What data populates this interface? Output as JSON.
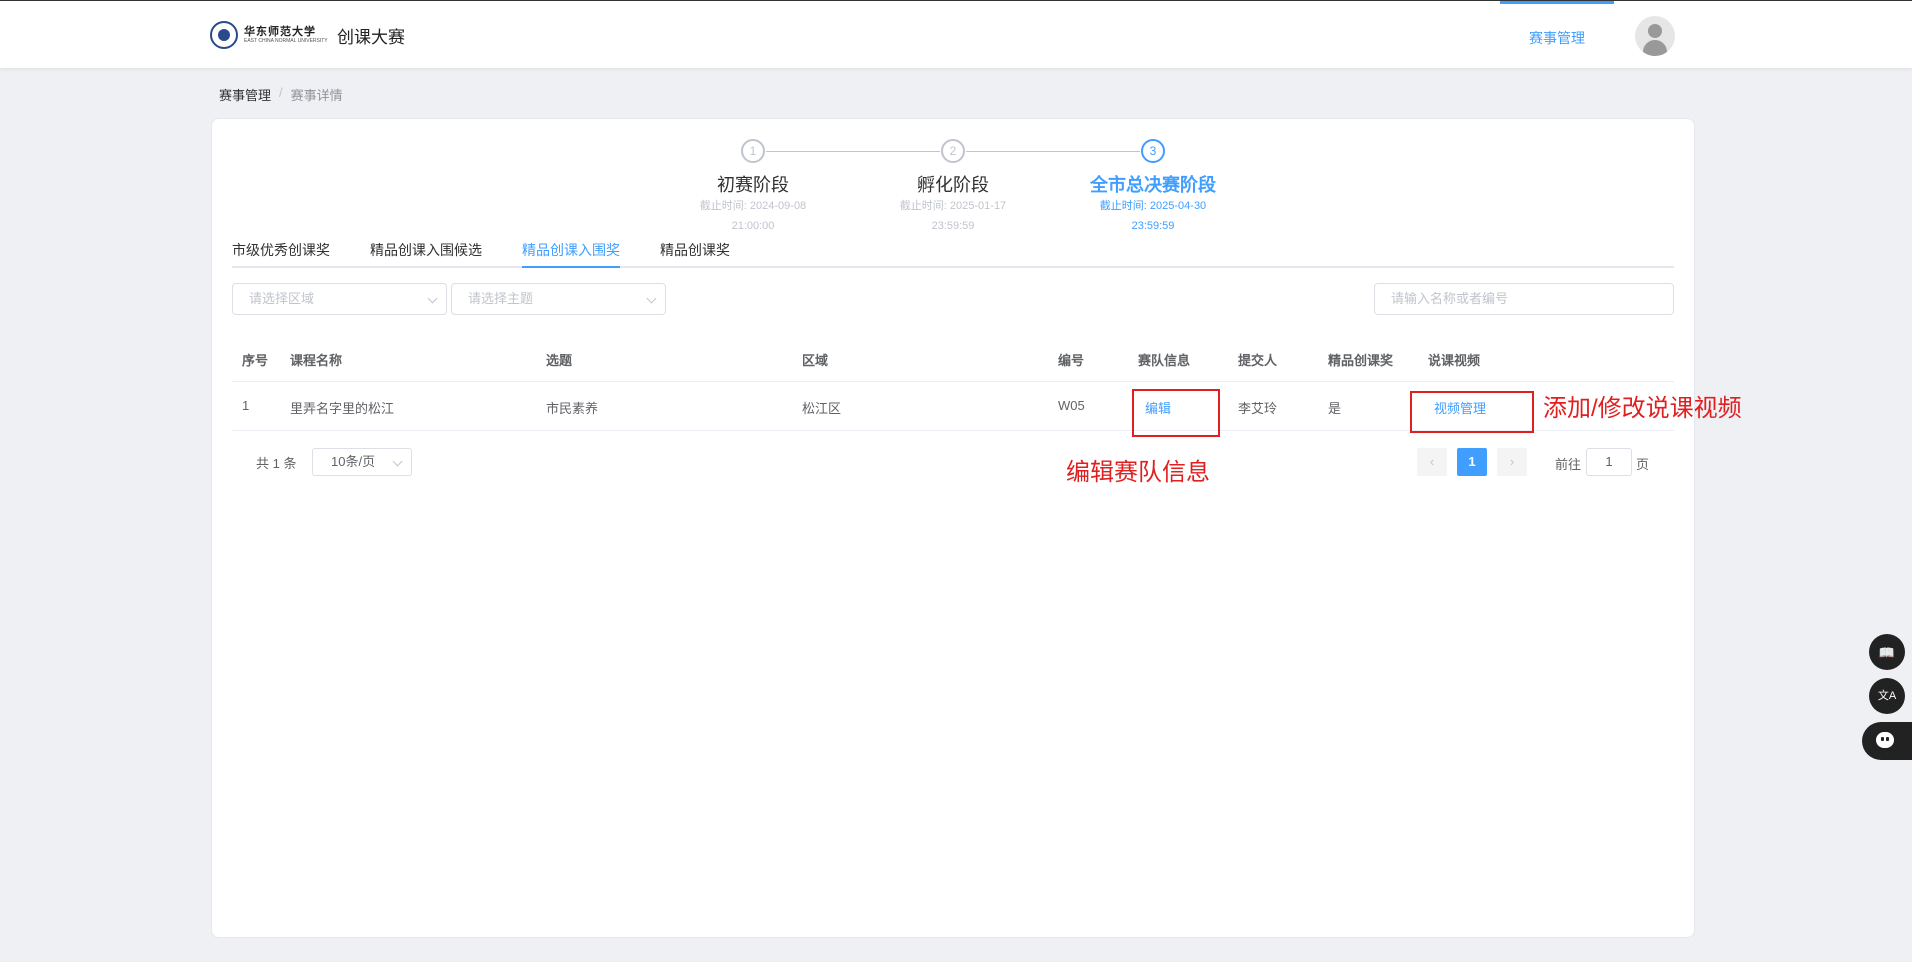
{
  "header": {
    "logo_text": "华东师范大学",
    "logo_subtext": "EAST CHINA NORMAL UNIVERSITY",
    "app_title": "创课大赛",
    "nav_active": "赛事管理"
  },
  "breadcrumb": {
    "first": "赛事管理",
    "separator": "/",
    "second": "赛事详情"
  },
  "steps": [
    {
      "number": "1",
      "title": "初赛阶段",
      "deadline_line1": "截止时间: 2024-09-08",
      "deadline_line2": "21:00:00"
    },
    {
      "number": "2",
      "title": "孵化阶段",
      "deadline_line1": "截止时间: 2025-01-17",
      "deadline_line2": "23:59:59"
    },
    {
      "number": "3",
      "title": "全市总决赛阶段",
      "deadline_line1": "截止时间: 2025-04-30",
      "deadline_line2": "23:59:59"
    }
  ],
  "tabs": [
    "市级优秀创课奖",
    "精品创课入围候选",
    "精品创课入围奖",
    "精品创课奖"
  ],
  "filters": {
    "region_placeholder": "请选择区域",
    "topic_placeholder": "请选择主题",
    "search_placeholder": "请输入名称或者编号"
  },
  "table": {
    "headers": [
      "序号",
      "课程名称",
      "选题",
      "区域",
      "编号",
      "赛队信息",
      "提交人",
      "精品创课奖",
      "说课视频"
    ],
    "rows": [
      {
        "index": "1",
        "course": "里弄名字里的松江",
        "topic": "市民素养",
        "region": "松江区",
        "code": "W05",
        "team": "编辑",
        "submitter": "李艾玲",
        "award": "是",
        "video": "视频管理"
      }
    ]
  },
  "annotations": {
    "edit_team": "编辑赛队信息",
    "video": "添加/修改说课视频"
  },
  "pagination": {
    "total": "共 1 条",
    "page_size": "10条/页",
    "prev": "‹",
    "current": "1",
    "next": "›",
    "goto_label": "前往",
    "goto_value": "1",
    "page_unit": "页"
  },
  "floating": {
    "book_icon": "📖",
    "translate_icon": "文A"
  },
  "colors": {
    "accent": "#409eff",
    "annotation": "#e02020"
  }
}
